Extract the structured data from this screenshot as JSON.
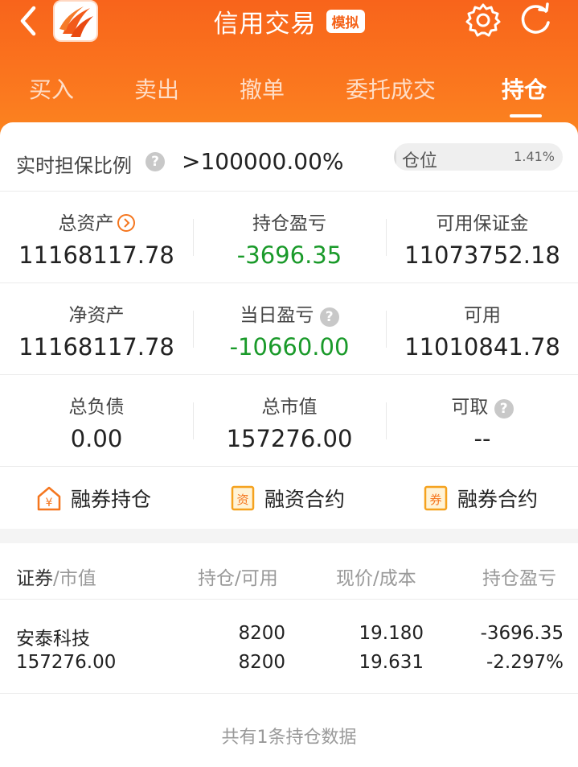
{
  "header": {
    "title": "信用交易",
    "badge": "模拟",
    "icons": [
      "back-icon",
      "app-logo",
      "gear-icon",
      "refresh-icon"
    ]
  },
  "tabs": [
    {
      "label": "买入",
      "active": false
    },
    {
      "label": "卖出",
      "active": false
    },
    {
      "label": "撤单",
      "active": false
    },
    {
      "label": "委托成交",
      "active": false
    },
    {
      "label": "持仓",
      "active": true
    }
  ],
  "ratio": {
    "label": "实时担保比例",
    "value": ">100000.00%",
    "position_label": "仓位",
    "position_pct": "1.41%",
    "position_fraction": 0.0141
  },
  "stats": [
    [
      {
        "label": "总资产",
        "value": "11168117.78"
      },
      {
        "label": "持仓盈亏",
        "value": "-3696.35"
      },
      {
        "label": "可用保证金",
        "value": "11073752.18"
      }
    ],
    [
      {
        "label": "净资产",
        "value": "11168117.78"
      },
      {
        "label": "当日盈亏",
        "value": "-10660.00"
      },
      {
        "label": "可用",
        "value": "11010841.78"
      }
    ],
    [
      {
        "label": "总负债",
        "value": "0.00"
      },
      {
        "label": "总市值",
        "value": "157276.00"
      },
      {
        "label": "可取",
        "value": "--"
      }
    ]
  ],
  "links": [
    {
      "label": "融券持仓",
      "icon": "yen-house-icon"
    },
    {
      "label": "融资合约",
      "icon": "zi-document-icon"
    },
    {
      "label": "融券合约",
      "icon": "quan-document-icon"
    }
  ],
  "table": {
    "headers": {
      "security": "证券",
      "market_value": "/市值",
      "holding": "持仓/可用",
      "price": "现价/成本",
      "pnl": "持仓盈亏"
    },
    "rows": [
      {
        "name": "安泰科技",
        "market_value": "157276.00",
        "holding": "8200",
        "available": "8200",
        "price": "19.180",
        "cost": "19.631",
        "pnl": "-3696.35",
        "pnl_pct": "-2.297%"
      }
    ]
  },
  "footer": {
    "text": "共有1条持仓数据"
  },
  "colors": {
    "brand": "#f8641b",
    "negative": "#1a9a2a",
    "icon_accent": "#f5761e"
  }
}
